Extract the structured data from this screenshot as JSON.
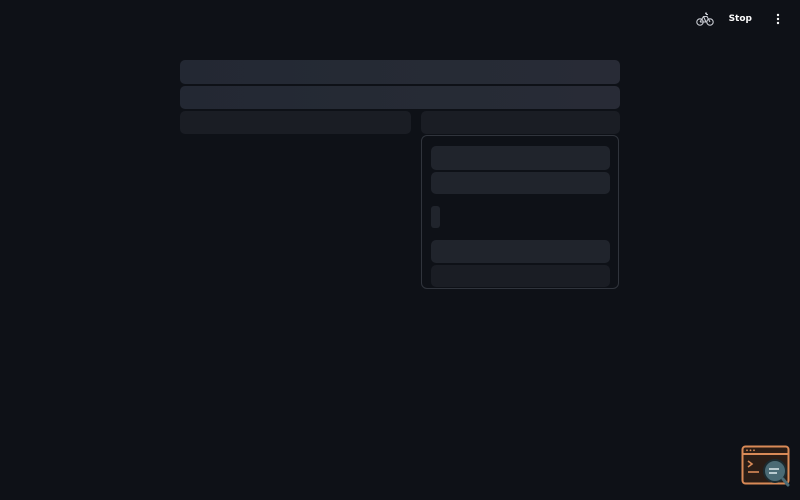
{
  "toolbar": {
    "status_icon": "bicycle-running-icon",
    "stop_label": "Stop",
    "menu_icon": "vertical-dots-menu-icon"
  },
  "loading_state": "skeleton-placeholders",
  "floating_widget": {
    "icon": "terminal-search-icon"
  },
  "colors": {
    "background": "#0e1117",
    "skeleton": "#262b35",
    "card_border": "#30343c",
    "widget_accent": "#d98a57",
    "widget_lens": "#4b6b75"
  }
}
